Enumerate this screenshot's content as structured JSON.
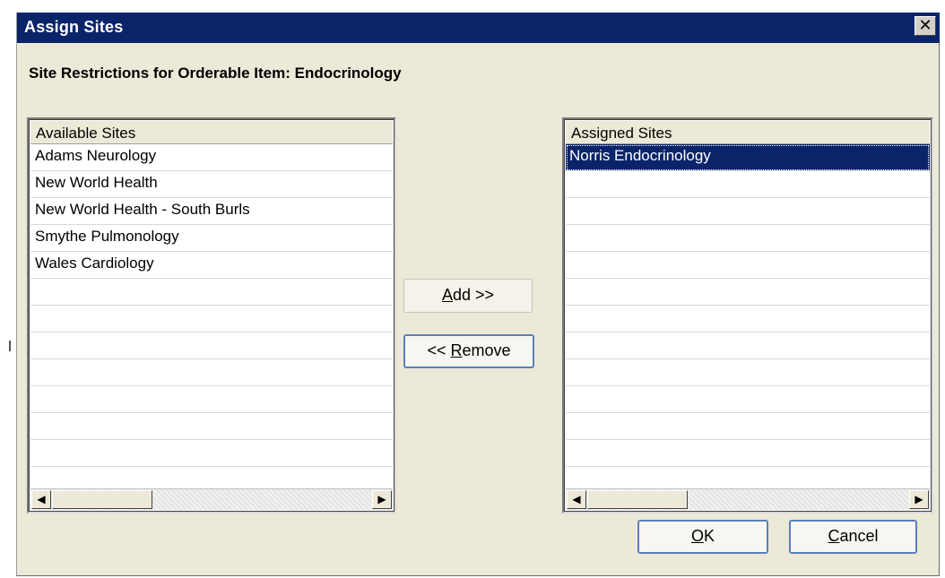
{
  "window": {
    "title": "Assign Sites",
    "close_glyph": "✕"
  },
  "heading": "Site Restrictions for Orderable Item: Endocrinology",
  "available": {
    "header": "Available Sites",
    "items": [
      "Adams Neurology",
      "New World Health",
      "New World Health - South Burls",
      "Smythe Pulmonology",
      "Wales Cardiology"
    ],
    "blank_rows": 7
  },
  "assigned": {
    "header": "Assigned Sites",
    "items": [
      "Norris Endocrinology"
    ],
    "selected_index": 0,
    "blank_rows": 11
  },
  "buttons": {
    "add": {
      "mnemonic": "A",
      "rest": "dd >>"
    },
    "remove": {
      "prefix": "<< ",
      "mnemonic": "R",
      "rest": "emove"
    },
    "ok": {
      "mnemonic": "O",
      "rest": "K"
    },
    "cancel": {
      "mnemonic": "C",
      "rest": "ancel"
    }
  },
  "scroll_glyphs": {
    "left": "◀",
    "right": "▶"
  },
  "colors": {
    "titlebar": "#0a246a",
    "selection": "#0a246a",
    "dialog_bg": "#ece9d8"
  }
}
